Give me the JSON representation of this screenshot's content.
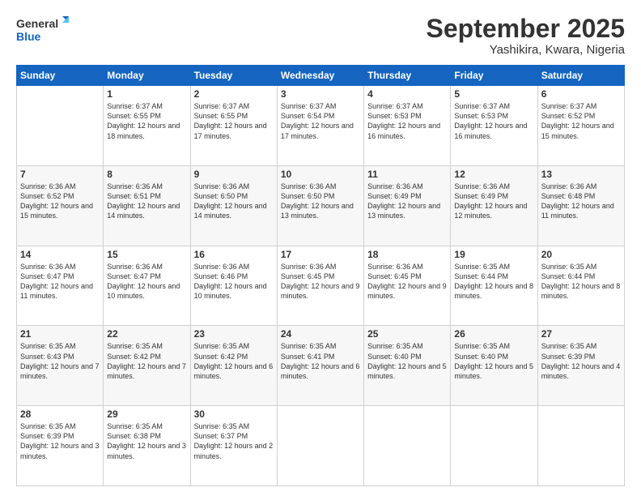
{
  "logo": {
    "line1": "General",
    "line2": "Blue"
  },
  "title": "September 2025",
  "location": "Yashikira, Kwara, Nigeria",
  "days_of_week": [
    "Sunday",
    "Monday",
    "Tuesday",
    "Wednesday",
    "Thursday",
    "Friday",
    "Saturday"
  ],
  "weeks": [
    [
      {
        "day": "",
        "sunrise": "",
        "sunset": "",
        "daylight": ""
      },
      {
        "day": "1",
        "sunrise": "Sunrise: 6:37 AM",
        "sunset": "Sunset: 6:55 PM",
        "daylight": "Daylight: 12 hours and 18 minutes."
      },
      {
        "day": "2",
        "sunrise": "Sunrise: 6:37 AM",
        "sunset": "Sunset: 6:55 PM",
        "daylight": "Daylight: 12 hours and 17 minutes."
      },
      {
        "day": "3",
        "sunrise": "Sunrise: 6:37 AM",
        "sunset": "Sunset: 6:54 PM",
        "daylight": "Daylight: 12 hours and 17 minutes."
      },
      {
        "day": "4",
        "sunrise": "Sunrise: 6:37 AM",
        "sunset": "Sunset: 6:53 PM",
        "daylight": "Daylight: 12 hours and 16 minutes."
      },
      {
        "day": "5",
        "sunrise": "Sunrise: 6:37 AM",
        "sunset": "Sunset: 6:53 PM",
        "daylight": "Daylight: 12 hours and 16 minutes."
      },
      {
        "day": "6",
        "sunrise": "Sunrise: 6:37 AM",
        "sunset": "Sunset: 6:52 PM",
        "daylight": "Daylight: 12 hours and 15 minutes."
      }
    ],
    [
      {
        "day": "7",
        "sunrise": "Sunrise: 6:36 AM",
        "sunset": "Sunset: 6:52 PM",
        "daylight": "Daylight: 12 hours and 15 minutes."
      },
      {
        "day": "8",
        "sunrise": "Sunrise: 6:36 AM",
        "sunset": "Sunset: 6:51 PM",
        "daylight": "Daylight: 12 hours and 14 minutes."
      },
      {
        "day": "9",
        "sunrise": "Sunrise: 6:36 AM",
        "sunset": "Sunset: 6:50 PM",
        "daylight": "Daylight: 12 hours and 14 minutes."
      },
      {
        "day": "10",
        "sunrise": "Sunrise: 6:36 AM",
        "sunset": "Sunset: 6:50 PM",
        "daylight": "Daylight: 12 hours and 13 minutes."
      },
      {
        "day": "11",
        "sunrise": "Sunrise: 6:36 AM",
        "sunset": "Sunset: 6:49 PM",
        "daylight": "Daylight: 12 hours and 13 minutes."
      },
      {
        "day": "12",
        "sunrise": "Sunrise: 6:36 AM",
        "sunset": "Sunset: 6:49 PM",
        "daylight": "Daylight: 12 hours and 12 minutes."
      },
      {
        "day": "13",
        "sunrise": "Sunrise: 6:36 AM",
        "sunset": "Sunset: 6:48 PM",
        "daylight": "Daylight: 12 hours and 11 minutes."
      }
    ],
    [
      {
        "day": "14",
        "sunrise": "Sunrise: 6:36 AM",
        "sunset": "Sunset: 6:47 PM",
        "daylight": "Daylight: 12 hours and 11 minutes."
      },
      {
        "day": "15",
        "sunrise": "Sunrise: 6:36 AM",
        "sunset": "Sunset: 6:47 PM",
        "daylight": "Daylight: 12 hours and 10 minutes."
      },
      {
        "day": "16",
        "sunrise": "Sunrise: 6:36 AM",
        "sunset": "Sunset: 6:46 PM",
        "daylight": "Daylight: 12 hours and 10 minutes."
      },
      {
        "day": "17",
        "sunrise": "Sunrise: 6:36 AM",
        "sunset": "Sunset: 6:45 PM",
        "daylight": "Daylight: 12 hours and 9 minutes."
      },
      {
        "day": "18",
        "sunrise": "Sunrise: 6:36 AM",
        "sunset": "Sunset: 6:45 PM",
        "daylight": "Daylight: 12 hours and 9 minutes."
      },
      {
        "day": "19",
        "sunrise": "Sunrise: 6:35 AM",
        "sunset": "Sunset: 6:44 PM",
        "daylight": "Daylight: 12 hours and 8 minutes."
      },
      {
        "day": "20",
        "sunrise": "Sunrise: 6:35 AM",
        "sunset": "Sunset: 6:44 PM",
        "daylight": "Daylight: 12 hours and 8 minutes."
      }
    ],
    [
      {
        "day": "21",
        "sunrise": "Sunrise: 6:35 AM",
        "sunset": "Sunset: 6:43 PM",
        "daylight": "Daylight: 12 hours and 7 minutes."
      },
      {
        "day": "22",
        "sunrise": "Sunrise: 6:35 AM",
        "sunset": "Sunset: 6:42 PM",
        "daylight": "Daylight: 12 hours and 7 minutes."
      },
      {
        "day": "23",
        "sunrise": "Sunrise: 6:35 AM",
        "sunset": "Sunset: 6:42 PM",
        "daylight": "Daylight: 12 hours and 6 minutes."
      },
      {
        "day": "24",
        "sunrise": "Sunrise: 6:35 AM",
        "sunset": "Sunset: 6:41 PM",
        "daylight": "Daylight: 12 hours and 6 minutes."
      },
      {
        "day": "25",
        "sunrise": "Sunrise: 6:35 AM",
        "sunset": "Sunset: 6:40 PM",
        "daylight": "Daylight: 12 hours and 5 minutes."
      },
      {
        "day": "26",
        "sunrise": "Sunrise: 6:35 AM",
        "sunset": "Sunset: 6:40 PM",
        "daylight": "Daylight: 12 hours and 5 minutes."
      },
      {
        "day": "27",
        "sunrise": "Sunrise: 6:35 AM",
        "sunset": "Sunset: 6:39 PM",
        "daylight": "Daylight: 12 hours and 4 minutes."
      }
    ],
    [
      {
        "day": "28",
        "sunrise": "Sunrise: 6:35 AM",
        "sunset": "Sunset: 6:39 PM",
        "daylight": "Daylight: 12 hours and 3 minutes."
      },
      {
        "day": "29",
        "sunrise": "Sunrise: 6:35 AM",
        "sunset": "Sunset: 6:38 PM",
        "daylight": "Daylight: 12 hours and 3 minutes."
      },
      {
        "day": "30",
        "sunrise": "Sunrise: 6:35 AM",
        "sunset": "Sunset: 6:37 PM",
        "daylight": "Daylight: 12 hours and 2 minutes."
      },
      {
        "day": "",
        "sunrise": "",
        "sunset": "",
        "daylight": ""
      },
      {
        "day": "",
        "sunrise": "",
        "sunset": "",
        "daylight": ""
      },
      {
        "day": "",
        "sunrise": "",
        "sunset": "",
        "daylight": ""
      },
      {
        "day": "",
        "sunrise": "",
        "sunset": "",
        "daylight": ""
      }
    ]
  ]
}
